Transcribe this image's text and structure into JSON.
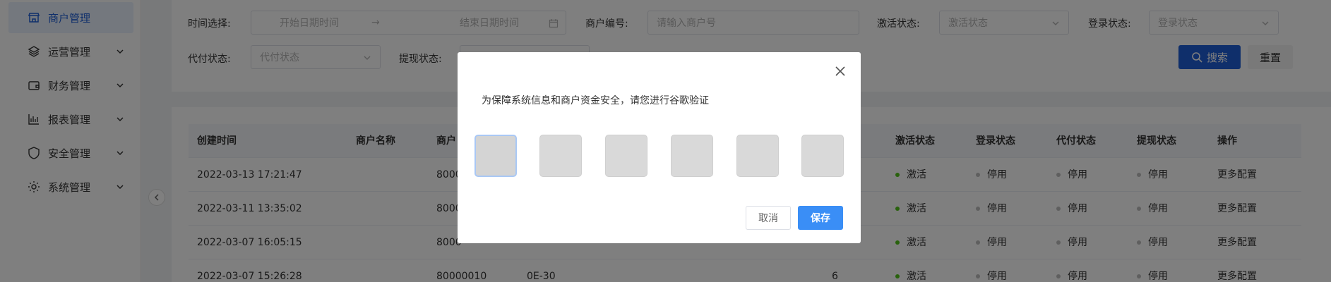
{
  "sidebar": {
    "items": [
      {
        "label": "商户管理",
        "icon": "store-icon",
        "active": true
      },
      {
        "label": "运营管理",
        "icon": "layers-icon"
      },
      {
        "label": "财务管理",
        "icon": "wallet-icon"
      },
      {
        "label": "报表管理",
        "icon": "bar-chart-icon"
      },
      {
        "label": "安全管理",
        "icon": "shield-icon"
      },
      {
        "label": "系统管理",
        "icon": "gear-icon"
      }
    ]
  },
  "filters": {
    "time_label": "时间选择:",
    "start_placeholder": "开始日期时间",
    "range_arrow": "→",
    "end_placeholder": "结束日期时间",
    "merchant_no_label": "商户编号:",
    "merchant_no_placeholder": "请输入商户号",
    "activate_label": "激活状态:",
    "activate_placeholder": "激活状态",
    "login_label": "登录状态:",
    "login_placeholder": "登录状态",
    "payment_label": "代付状态:",
    "payment_placeholder": "代付状态",
    "withdraw_label": "提现状态:",
    "search_label": "搜索",
    "reset_label": "重置"
  },
  "table": {
    "headers": {
      "created": "创建时间",
      "name": "商户名称",
      "merchant": "商户",
      "activate": "激活状态",
      "login": "登录状态",
      "payment": "代付状态",
      "withdraw": "提现状态",
      "action": "操作"
    },
    "rows": [
      {
        "created": "2022-03-13 17:21:47",
        "merchant": "8000",
        "rate": "",
        "num": "",
        "activate": "激活",
        "login": "停用",
        "payment": "停用",
        "withdraw": "停用",
        "action": "更多配置"
      },
      {
        "created": "2022-03-11 13:35:02",
        "merchant": "8000",
        "rate": "",
        "num": "",
        "activate": "激活",
        "login": "停用",
        "payment": "停用",
        "withdraw": "停用",
        "action": "更多配置"
      },
      {
        "created": "2022-03-07 16:05:15",
        "merchant": "8000",
        "rate": "",
        "num": "",
        "activate": "激活",
        "login": "停用",
        "payment": "停用",
        "withdraw": "停用",
        "action": "更多配置"
      },
      {
        "created": "2022-03-07 15:26:28",
        "merchant": "80000010",
        "rate": "0E-30",
        "num": "6",
        "activate": "激活",
        "login": "停用",
        "payment": "停用",
        "withdraw": "停用",
        "action": "更多配置"
      }
    ]
  },
  "dialog": {
    "message": "为保障系统信息和商户资金安全，请您进行谷歌验证",
    "code_boxes": [
      "",
      "",
      "",
      "",
      "",
      ""
    ],
    "cancel_label": "取消",
    "save_label": "保存"
  },
  "colors": {
    "primary": "#1f5fd6",
    "save": "#3a8ef6",
    "active_dot": "#52c41a",
    "inactive_dot": "#bfbfbf"
  }
}
